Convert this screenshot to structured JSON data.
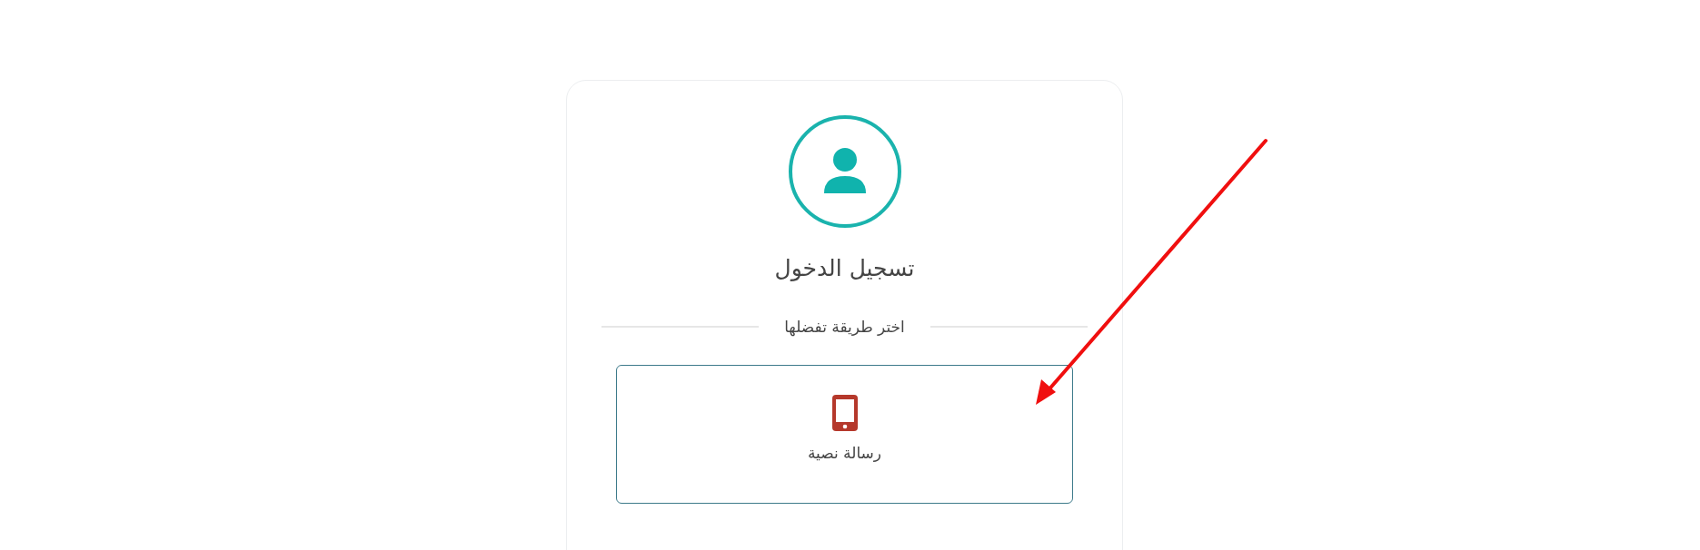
{
  "login": {
    "title": "تسجيل الدخول",
    "divider_text": "اختر طريقة تفضلها",
    "options": [
      {
        "kind": "sms",
        "label": "رسالة نصية"
      }
    ]
  }
}
